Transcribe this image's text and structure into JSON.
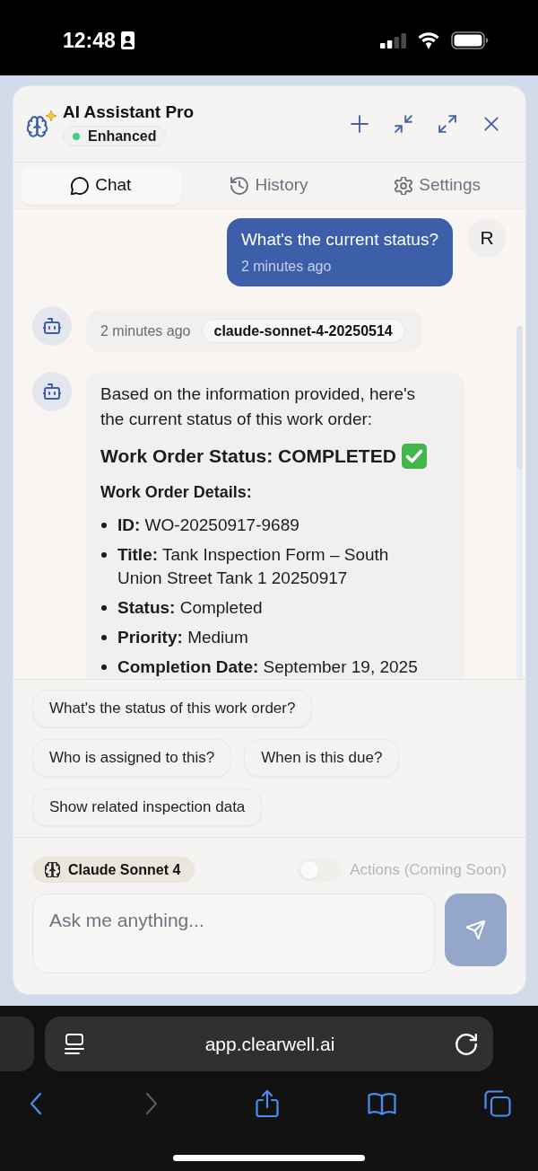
{
  "status_bar": {
    "time": "12:48"
  },
  "assistant": {
    "title": "AI Assistant Pro",
    "badge": "Enhanced"
  },
  "tabs": [
    {
      "kind": "chat",
      "label": "Chat",
      "selected": true
    },
    {
      "kind": "history",
      "label": "History",
      "selected": false
    },
    {
      "kind": "settings",
      "label": "Settings",
      "selected": false
    }
  ],
  "messages": [
    {
      "kind": "user",
      "text": "What's the current status?",
      "time": "2 minutes ago",
      "avatar": "R"
    },
    {
      "kind": "meta",
      "time": "2 minutes ago",
      "model": "claude-sonnet-4-20250514"
    },
    {
      "kind": "assistant",
      "paragraph": "Based on the information provided, here's the current status of this work order:",
      "heading": "Work Order Status: COMPLETED",
      "subheading": "Work Order Details:",
      "details": [
        "**ID:** WO-20250917-9689",
        "**Title:** Tank Inspection Form – South Union Street Tank 1 20250917",
        "**Status:** Completed",
        "**Priority:** Medium",
        "**Completion Date:** September 19, 2025"
      ]
    }
  ],
  "suggestions": [
    "What's the status of this work order?",
    "Who is assigned to this?",
    "When is this due?",
    "Show related inspection data"
  ],
  "model_badge": "Claude Sonnet 4",
  "actions": {
    "label": "Actions (Coming Soon)",
    "on": false,
    "disabled": true
  },
  "composer": {
    "placeholder": "Ask me anything...",
    "send_button": {
      "disabled": true
    }
  },
  "browser": {
    "url": "app.clearwell.ai",
    "nav_buttons": [
      {
        "kind": "back",
        "disabled": false
      },
      {
        "kind": "forward",
        "disabled": true
      },
      {
        "kind": "share",
        "disabled": false
      },
      {
        "kind": "bookmarks",
        "disabled": false
      },
      {
        "kind": "tabs",
        "disabled": false
      }
    ]
  }
}
